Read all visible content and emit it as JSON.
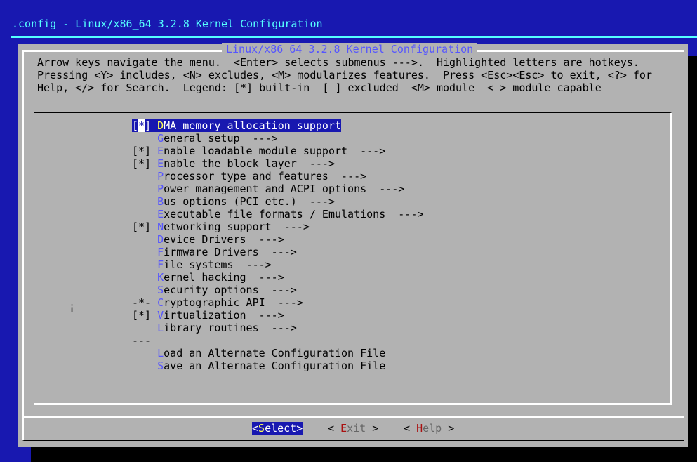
{
  "screen_title": ".config - Linux/x86_64 3.2.8 Kernel Configuration",
  "dialog_title": "Linux/x86_64 3.2.8 Kernel Configuration",
  "help_lines": [
    "Arrow keys navigate the menu.  <Enter> selects submenus --->.  Highlighted letters are hotkeys.",
    "Pressing <Y> includes, <N> excludes, <M> modularizes features.  Press <Esc><Esc> to exit, <?> for",
    "Help, </> for Search.  Legend: [*] built-in  [ ] excluded  <M> module  < > module capable"
  ],
  "stray_char": "¡",
  "menu_items": [
    {
      "prefix": "[*]",
      "hotkey": "D",
      "rest": "MA memory allocation support",
      "selected": true
    },
    {
      "prefix": "   ",
      "hotkey": "G",
      "rest": "eneral setup  --->"
    },
    {
      "prefix": "[*]",
      "hotkey": "E",
      "rest": "nable loadable module support  --->"
    },
    {
      "prefix": "[*]",
      "hotkey": "E",
      "rest": "nable the block layer  --->"
    },
    {
      "prefix": "   ",
      "hotkey": "P",
      "rest": "rocessor type and features  --->"
    },
    {
      "prefix": "   ",
      "hotkey": "P",
      "rest": "ower management and ACPI options  --->"
    },
    {
      "prefix": "   ",
      "hotkey": "B",
      "rest": "us options (PCI etc.)  --->"
    },
    {
      "prefix": "   ",
      "hotkey": "E",
      "rest": "xecutable file formats / Emulations  --->"
    },
    {
      "prefix": "[*]",
      "hotkey": "N",
      "rest": "etworking support  --->"
    },
    {
      "prefix": "   ",
      "hotkey": "D",
      "rest": "evice Drivers  --->"
    },
    {
      "prefix": "   ",
      "hotkey": "F",
      "rest": "irmware Drivers  --->"
    },
    {
      "prefix": "   ",
      "hotkey": "F",
      "rest": "ile systems  --->"
    },
    {
      "prefix": "   ",
      "hotkey": "K",
      "rest": "ernel hacking  --->"
    },
    {
      "prefix": "   ",
      "hotkey": "S",
      "rest": "ecurity options  --->"
    },
    {
      "prefix": "-*-",
      "hotkey": "C",
      "rest": "ryptographic API  --->"
    },
    {
      "prefix": "[*]",
      "hotkey": "V",
      "rest": "irtualization  --->"
    },
    {
      "prefix": "   ",
      "hotkey": "L",
      "rest": "ibrary routines  --->"
    },
    {
      "prefix": "---",
      "hotkey": "",
      "rest": ""
    },
    {
      "prefix": "   ",
      "hotkey": "L",
      "rest": "oad an Alternate Configuration File"
    },
    {
      "prefix": "   ",
      "hotkey": "S",
      "rest": "ave an Alternate Configuration File"
    }
  ],
  "buttons": [
    {
      "left": "<",
      "hotkey": "S",
      "rest": "elect",
      "right": ">",
      "selected": true
    },
    {
      "left": "< ",
      "hotkey": "E",
      "rest": "xit",
      "right": " >"
    },
    {
      "left": "< ",
      "hotkey": "H",
      "rest": "elp",
      "right": " >"
    }
  ],
  "colors": {
    "background": "#1818b0",
    "title": "#55ffff",
    "dialog": "#b2b2b2",
    "hotkey": "#5555ff",
    "selected_hotkey": "#ffff55",
    "button_hotkey": "#aa1111"
  }
}
